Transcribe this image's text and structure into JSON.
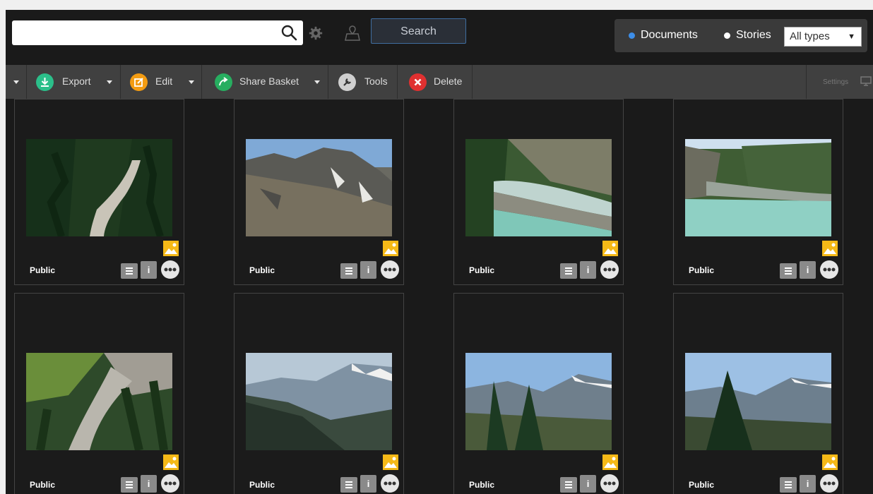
{
  "search": {
    "value": "",
    "placeholder": "",
    "button_label": "Search"
  },
  "filters": {
    "documents_label": "Documents",
    "stories_label": "Stories",
    "type_value": "All types",
    "documents_color": "#3d8ee8",
    "stories_color": "#ffffff"
  },
  "toolbar": {
    "export_label": "Export",
    "edit_label": "Edit",
    "share_label": "Share Basket",
    "tools_label": "Tools",
    "delete_label": "Delete",
    "settings_label": "Settings",
    "colors": {
      "export": "#2bbf8a",
      "edit": "#f39c12",
      "share": "#27ae60",
      "tools": "#cccccc",
      "delete": "#e03030"
    }
  },
  "grid": {
    "items": [
      {
        "label": "Public",
        "icon": "image-icon",
        "info": "i"
      },
      {
        "label": "Public",
        "icon": "image-icon",
        "info": "i"
      },
      {
        "label": "Public",
        "icon": "image-icon",
        "info": "i"
      },
      {
        "label": "Public",
        "icon": "image-icon",
        "info": "i"
      },
      {
        "label": "Public",
        "icon": "image-icon",
        "info": "i"
      },
      {
        "label": "Public",
        "icon": "image-icon",
        "info": "i"
      },
      {
        "label": "Public",
        "icon": "image-icon",
        "info": "i"
      },
      {
        "label": "Public",
        "icon": "image-icon",
        "info": "i"
      }
    ]
  }
}
